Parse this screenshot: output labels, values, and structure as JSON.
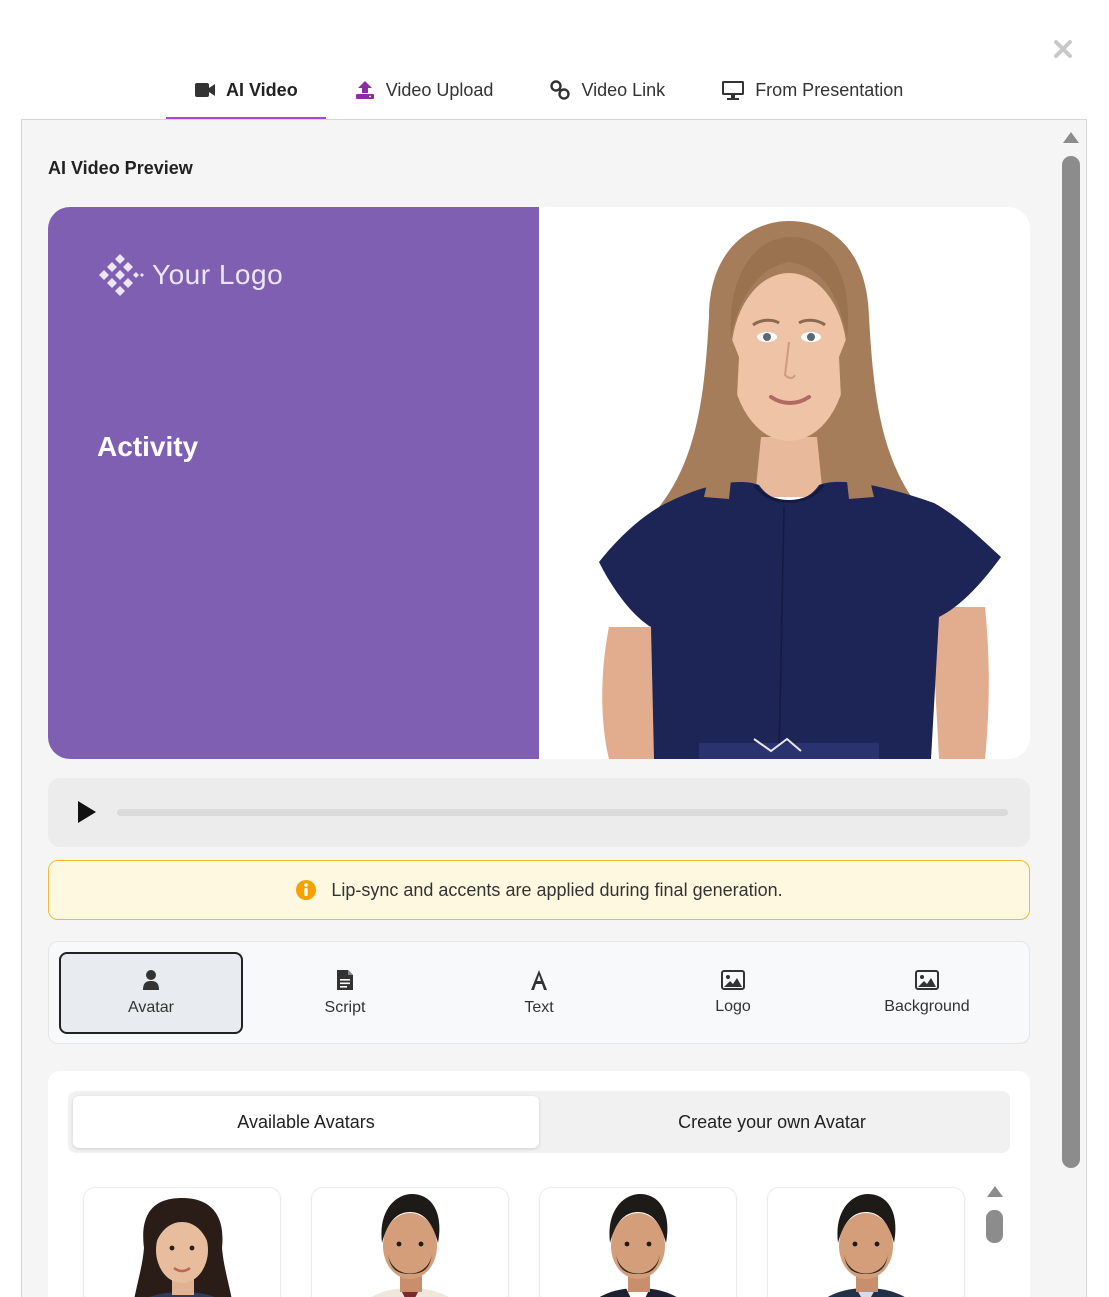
{
  "tabs": [
    {
      "label": "AI Video",
      "icon": "video-camera-icon",
      "active": true
    },
    {
      "label": "Video Upload",
      "icon": "upload-icon",
      "active": false
    },
    {
      "label": "Video Link",
      "icon": "link-icon",
      "active": false
    },
    {
      "label": "From Presentation",
      "icon": "monitor-icon",
      "active": false
    }
  ],
  "preview": {
    "title": "AI Video Preview",
    "logo_text": "Your Logo",
    "slide_title": "Activity",
    "background_color": "#7f5fb1"
  },
  "player": {
    "progress": 0
  },
  "notice": {
    "text": "Lip-sync and accents are applied during final generation.",
    "icon": "info-icon"
  },
  "tools": [
    {
      "label": "Avatar",
      "icon": "user-icon",
      "active": true
    },
    {
      "label": "Script",
      "icon": "document-icon",
      "active": false
    },
    {
      "label": "Text",
      "icon": "text-icon",
      "active": false
    },
    {
      "label": "Logo",
      "icon": "image-icon",
      "active": false
    },
    {
      "label": "Background",
      "icon": "image-icon",
      "active": false
    }
  ],
  "avatars": {
    "tabs": [
      {
        "label": "Available Avatars",
        "active": true
      },
      {
        "label": "Create your own Avatar",
        "active": false
      }
    ]
  },
  "colors": {
    "accent": "#a64ad6",
    "notice_border": "#f0b93a",
    "notice_icon": "#f5a100"
  }
}
